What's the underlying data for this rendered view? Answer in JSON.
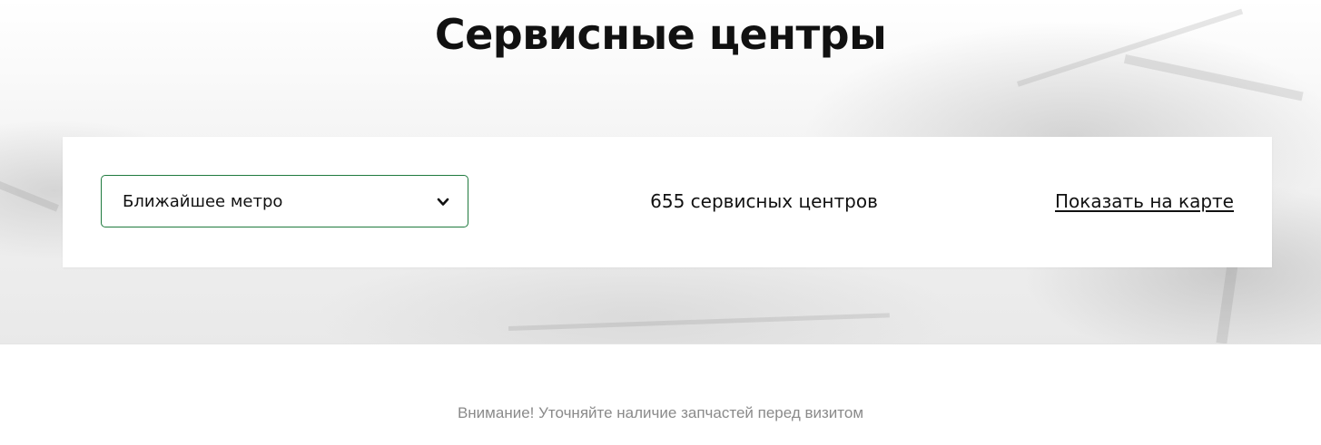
{
  "page": {
    "title": "Сервисные центры"
  },
  "filters": {
    "metro_select_value": "Ближайшее метро",
    "service_count": "655 сервисных центров",
    "show_on_map_link": "Показать на карте"
  },
  "notice": {
    "text": "Внимание! Уточняйте наличие запчастей перед визитом"
  },
  "icons": {
    "dropdown": "chevron-down-icon"
  },
  "colors": {
    "select_border": "#1f7a3e",
    "notice_text": "#8a8a8a"
  }
}
